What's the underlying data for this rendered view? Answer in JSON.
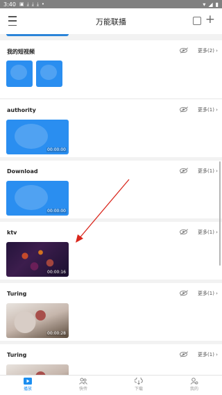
{
  "status_bar": {
    "time": "3:40"
  },
  "header": {
    "title": "万能联播"
  },
  "sections": [
    {
      "title": "我的短视频",
      "more": "更多(2) ›"
    },
    {
      "title": "authority",
      "more": "更多(1) ›",
      "duration": "00:00:00"
    },
    {
      "title": "Download",
      "more": "更多(1) ›",
      "duration": "00:00:00"
    },
    {
      "title": "ktv",
      "more": "更多(1) ›",
      "duration": "00:00:16"
    },
    {
      "title": "Turing",
      "more": "更多(1) ›",
      "duration": "00:00:28"
    },
    {
      "title": "Turing",
      "more": "更多(1) ›"
    }
  ],
  "tabs": [
    {
      "label": "播放",
      "icon": "play-icon"
    },
    {
      "label": "快传",
      "icon": "transfer-icon"
    },
    {
      "label": "下载",
      "icon": "download-icon"
    },
    {
      "label": "我的",
      "icon": "profile-icon"
    }
  ],
  "colors": {
    "accent": "#1b8ef0",
    "thumb_blue": "#2a8ef0",
    "arrow": "#d9261c"
  }
}
